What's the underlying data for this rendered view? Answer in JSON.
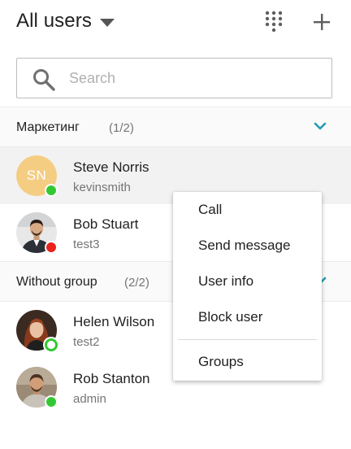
{
  "header": {
    "title": "All users"
  },
  "search": {
    "value": "",
    "placeholder": "Search"
  },
  "groups": [
    {
      "name": "Маркетинг",
      "count": "(1/2)",
      "users": [
        {
          "name": "Steve Norris",
          "login": "kevinsmith",
          "initials": "SN",
          "status": "online",
          "selected": true
        },
        {
          "name": "Bob Stuart",
          "login": "test3",
          "status": "busy"
        }
      ]
    },
    {
      "name": "Without group",
      "count": "(2/2)",
      "users": [
        {
          "name": "Helen Wilson",
          "login": "test2",
          "status": "away"
        },
        {
          "name": "Rob Stanton",
          "login": "admin",
          "status": "online"
        }
      ]
    }
  ],
  "context_menu": {
    "items": [
      "Call",
      "Send message",
      "User info",
      "Block user",
      "Groups"
    ]
  },
  "colors": {
    "accent": "#1e9bb4",
    "online": "#33c833",
    "busy": "#e8231c",
    "avatar_initials_bg": "#f5cd82",
    "selected_row": "#f2f2f2"
  },
  "icons": {
    "title_dropdown": "caret-down-icon",
    "dialpad": "dialpad-icon",
    "add": "plus-icon",
    "search": "search-icon",
    "group_toggle": "chevron-down-icon"
  }
}
